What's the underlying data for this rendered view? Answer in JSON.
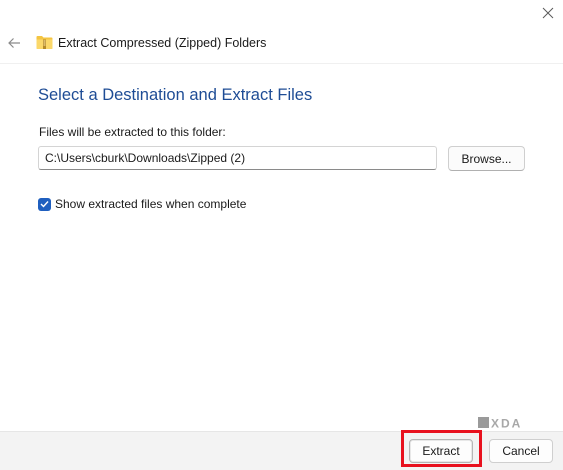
{
  "window": {
    "title": "Extract Compressed (Zipped) Folders",
    "icons": {
      "close": "close-icon",
      "back": "back-arrow-icon",
      "folder": "zip-folder-icon"
    }
  },
  "main": {
    "heading": "Select a Destination and Extract Files",
    "destination_label": "Files will be extracted to this folder:",
    "destination_path": "C:\\Users\\cburk\\Downloads\\Zipped (2)",
    "browse_label": "Browse...",
    "show_files_checkbox": {
      "label": "Show extracted files when complete",
      "checked": true
    }
  },
  "footer": {
    "extract_label": "Extract",
    "cancel_label": "Cancel"
  },
  "watermark": {
    "text": "XDA"
  },
  "colors": {
    "heading": "#1e4c95",
    "checkbox": "#1f5fbf",
    "highlight": "#e8111e",
    "footer_bg": "#f3f3f3"
  }
}
